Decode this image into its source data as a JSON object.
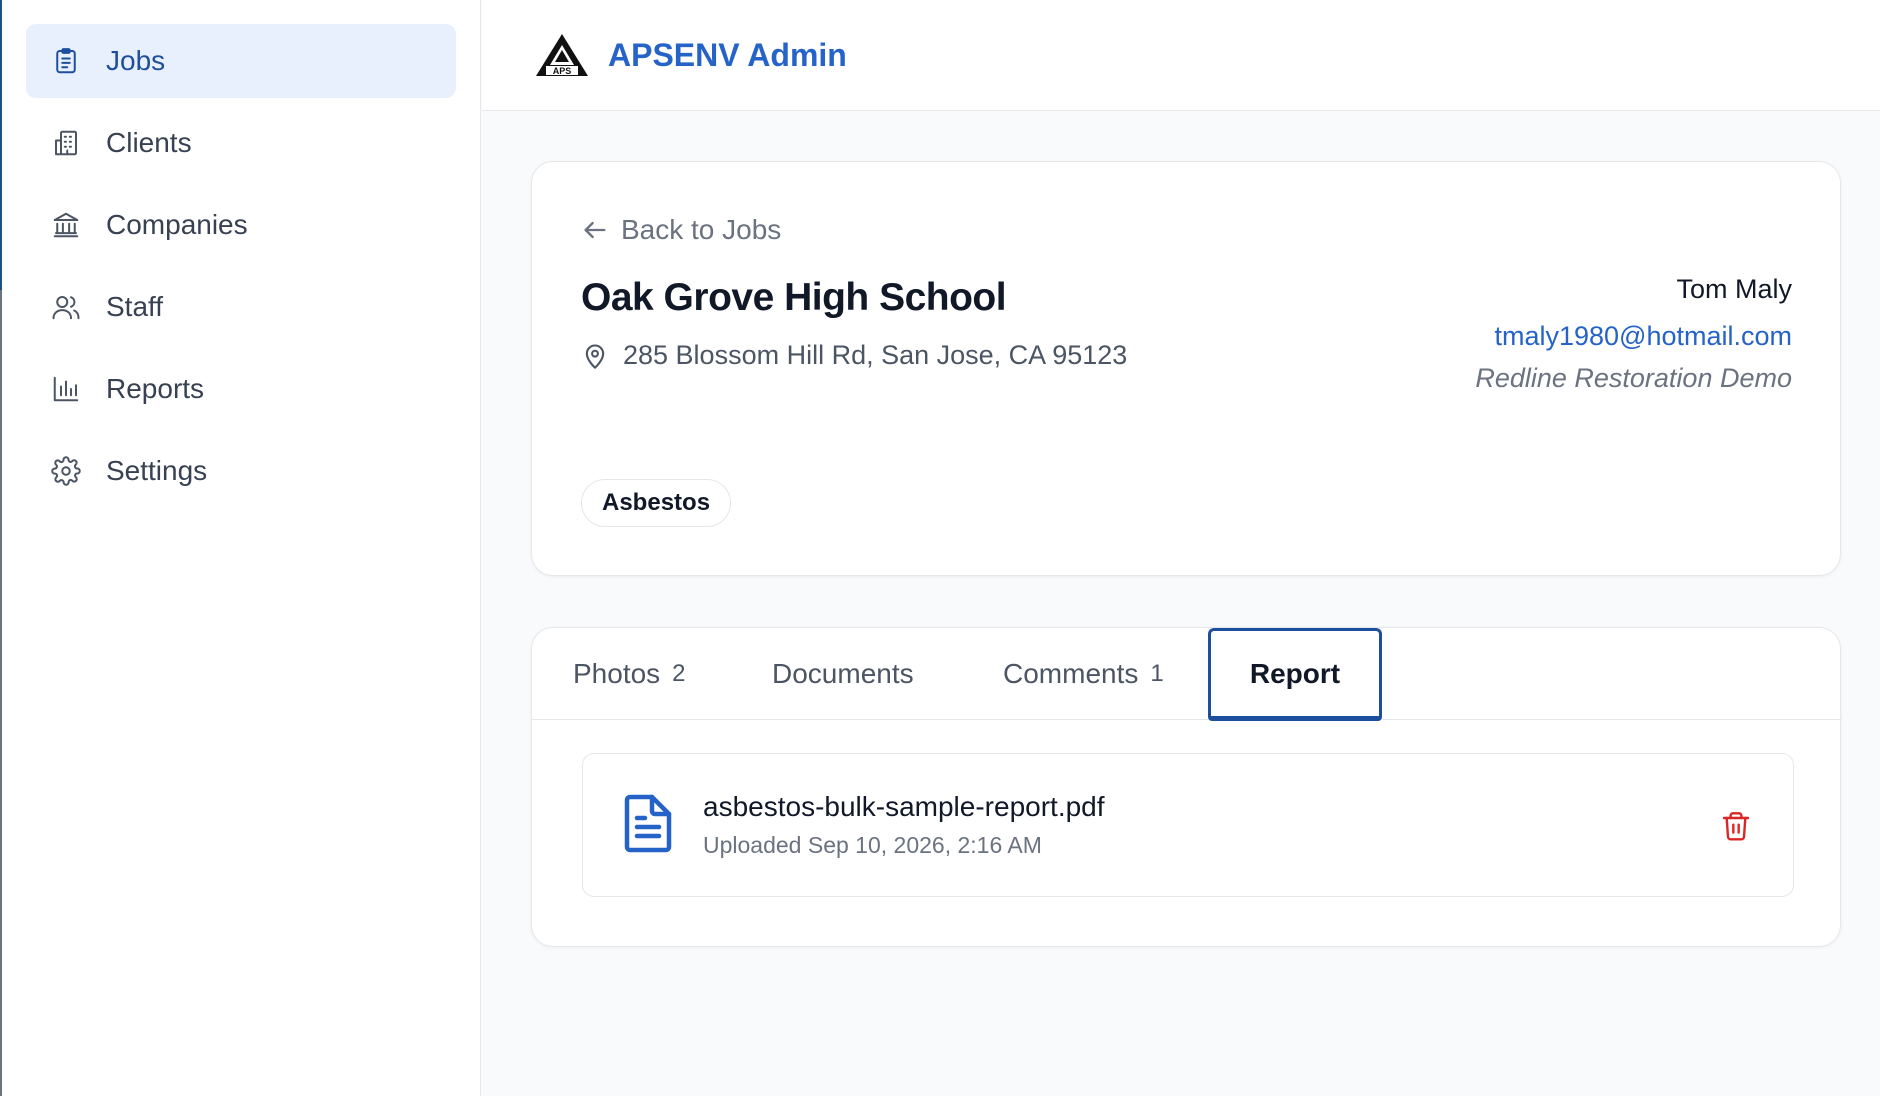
{
  "app": {
    "title": "APSENV Admin",
    "brand_color": "#2563c9",
    "logo_label": "APS"
  },
  "sidebar": {
    "items": [
      {
        "label": "Jobs",
        "icon": "clipboard-icon",
        "active": true
      },
      {
        "label": "Clients",
        "icon": "building-icon",
        "active": false
      },
      {
        "label": "Companies",
        "icon": "bank-icon",
        "active": false
      },
      {
        "label": "Staff",
        "icon": "users-icon",
        "active": false
      },
      {
        "label": "Reports",
        "icon": "bar-chart-icon",
        "active": false
      },
      {
        "label": "Settings",
        "icon": "gear-icon",
        "active": false
      }
    ]
  },
  "job": {
    "back_label": "Back to Jobs",
    "title": "Oak Grove High School",
    "address": "285 Blossom Hill Rd, San Jose, CA 95123",
    "contact": {
      "name": "Tom Maly",
      "email": "tmaly1980@hotmail.com",
      "company": "Redline Restoration Demo"
    },
    "tags": [
      "Asbestos"
    ]
  },
  "tabs": [
    {
      "label": "Photos",
      "count": "2",
      "active": false
    },
    {
      "label": "Documents",
      "count": "",
      "active": false
    },
    {
      "label": "Comments",
      "count": "1",
      "active": false
    },
    {
      "label": "Report",
      "count": "",
      "active": true
    }
  ],
  "report": {
    "file_name": "asbestos-bulk-sample-report.pdf",
    "uploaded": "Uploaded Sep 10, 2026, 2:16 AM",
    "file_icon": "document-icon",
    "delete_icon": "trash-icon",
    "delete_color": "#dc2626"
  }
}
